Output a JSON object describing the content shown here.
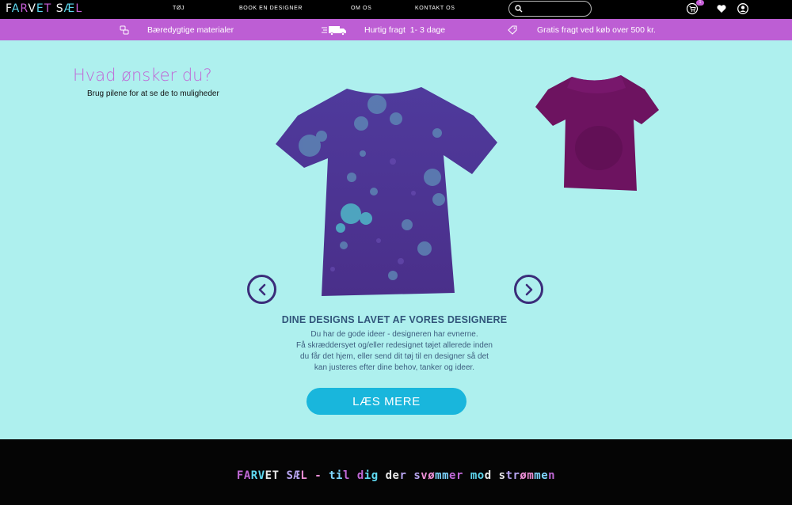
{
  "brand": {
    "logo_parts": [
      "F",
      "A",
      "R",
      "V",
      "E",
      "T",
      " ",
      "S",
      "Æ",
      "L"
    ],
    "logo_text": "FARVET SÆL",
    "colors": {
      "purple": "#bd5ed4",
      "cyan": "#19b6dc",
      "background": "#aef0ee",
      "navy": "#3b2d7a"
    }
  },
  "nav": {
    "links": [
      "TØJ",
      "BOOK EN DESIGNER",
      "OM OS",
      "KONTAKT OS"
    ],
    "search": {
      "placeholder": "",
      "icon": "search-icon"
    },
    "cart_badge": "1",
    "icons": [
      "cart-icon",
      "heart-icon",
      "user-icon"
    ]
  },
  "features": [
    {
      "icon": "recycle-icon",
      "label": "Bæredygtige materialer"
    },
    {
      "icon": "truck-icon",
      "label": "Hurtig fragt  1- 3 dage"
    },
    {
      "icon": "tag-icon",
      "label": "Gratis fragt ved køb over 500 kr."
    }
  ],
  "hero": {
    "title": "Hvad ønsker du?",
    "subtitle": "Brug pilene for at se de to muligheder"
  },
  "carousel": {
    "current_title": "DINE DESIGNS LAVET AF VORES DESIGNERE",
    "description_lines": [
      "Du har de gode ideer - designeren har evnerne.",
      "Få skræddersyet og/eller redesignet tøjet allerede inden",
      "du får det hjem, eller send dit tøj til en designer så det",
      "kan justeres efter dine behov, tanker og ideer."
    ],
    "read_more_label": "LÆS MERE"
  },
  "footer": {
    "tagline": "FARVET SÆL - til dig der svømmer mod strømmen"
  }
}
